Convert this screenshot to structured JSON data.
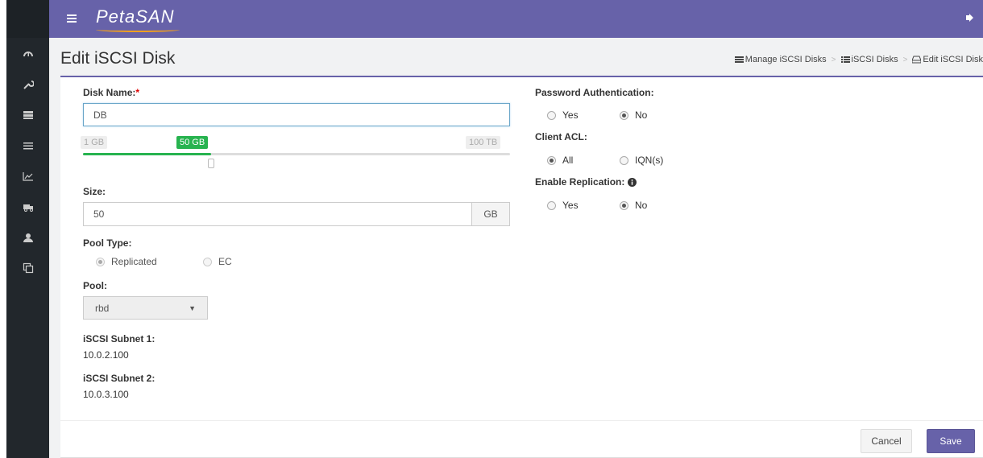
{
  "app": {
    "brand": "PetaSAN"
  },
  "page": {
    "title": "Edit iSCSI Disk"
  },
  "breadcrumb": [
    {
      "label": "Manage iSCSI Disks"
    },
    {
      "label": "iSCSI Disks"
    },
    {
      "label": "Edit iSCSI Disk"
    }
  ],
  "form": {
    "disk_name": {
      "label": "Disk Name:",
      "required_mark": "*",
      "value": "DB"
    },
    "slider": {
      "min_label": "1 GB",
      "current_label": "50 GB",
      "max_label": "100 TB",
      "progress_percent": 30
    },
    "size": {
      "label": "Size:",
      "value": "50",
      "unit": "GB"
    },
    "pool_type": {
      "label": "Pool Type:",
      "options": [
        "Replicated",
        "EC"
      ],
      "selected": "Replicated"
    },
    "pool": {
      "label": "Pool:",
      "selected": "rbd"
    },
    "subnet1": {
      "label": "iSCSI Subnet 1:",
      "value": "10.0.2.100"
    },
    "subnet2": {
      "label": "iSCSI Subnet 2:",
      "value": "10.0.3.100"
    },
    "password_auth": {
      "label": "Password Authentication:",
      "options": [
        "Yes",
        "No"
      ],
      "selected": "No"
    },
    "client_acl": {
      "label": "Client ACL:",
      "options": [
        "All",
        "IQN(s)"
      ],
      "selected": "All"
    },
    "replication": {
      "label": "Enable Replication:",
      "options": [
        "Yes",
        "No"
      ],
      "selected": "No"
    }
  },
  "buttons": {
    "cancel": "Cancel",
    "save": "Save"
  },
  "colors": {
    "accent": "#6762a9",
    "sidebar": "#22272c",
    "success": "#27b34f"
  },
  "sidebar_icons": [
    "dashboard-icon",
    "wrench-icon",
    "server-icon",
    "list-icon",
    "chart-icon",
    "truck-icon",
    "users-icon",
    "copy-icon"
  ]
}
